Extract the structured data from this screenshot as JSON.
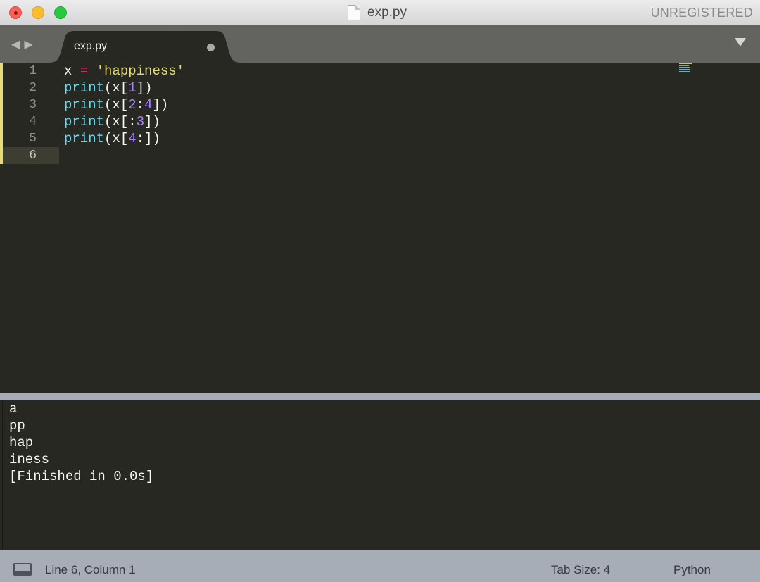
{
  "window": {
    "title": "exp.py",
    "license_status": "UNREGISTERED"
  },
  "tabs": [
    {
      "label": "exp.py",
      "modified": true
    }
  ],
  "editor": {
    "line_numbers": [
      "1",
      "2",
      "3",
      "4",
      "5",
      "6"
    ],
    "current_line": 6,
    "lines": [
      [
        {
          "t": "x ",
          "c": "pl"
        },
        {
          "t": "=",
          "c": "op"
        },
        {
          "t": " ",
          "c": "pl"
        },
        {
          "t": "'happiness'",
          "c": "str"
        }
      ],
      [
        {
          "t": "print",
          "c": "kw"
        },
        {
          "t": "(x[",
          "c": "pl"
        },
        {
          "t": "1",
          "c": "num"
        },
        {
          "t": "])",
          "c": "pl"
        }
      ],
      [
        {
          "t": "print",
          "c": "kw"
        },
        {
          "t": "(x[",
          "c": "pl"
        },
        {
          "t": "2",
          "c": "num"
        },
        {
          "t": ":",
          "c": "pl"
        },
        {
          "t": "4",
          "c": "num"
        },
        {
          "t": "])",
          "c": "pl"
        }
      ],
      [
        {
          "t": "print",
          "c": "kw"
        },
        {
          "t": "(x[:",
          "c": "pl"
        },
        {
          "t": "3",
          "c": "num"
        },
        {
          "t": "])",
          "c": "pl"
        }
      ],
      [
        {
          "t": "print",
          "c": "kw"
        },
        {
          "t": "(x[",
          "c": "pl"
        },
        {
          "t": "4",
          "c": "num"
        },
        {
          "t": ":])",
          "c": "pl"
        }
      ],
      []
    ]
  },
  "output": {
    "lines": [
      "a",
      "pp",
      "hap",
      "iness",
      "[Finished in 0.0s]"
    ]
  },
  "statusbar": {
    "position": "Line 6, Column 1",
    "tab_size": "Tab Size: 4",
    "syntax": "Python"
  },
  "colors": {
    "background": "#272822",
    "keyword": "#66d9ef",
    "operator": "#f92672",
    "string": "#e6db74",
    "number": "#ae81ff",
    "text": "#f8f8f2"
  }
}
